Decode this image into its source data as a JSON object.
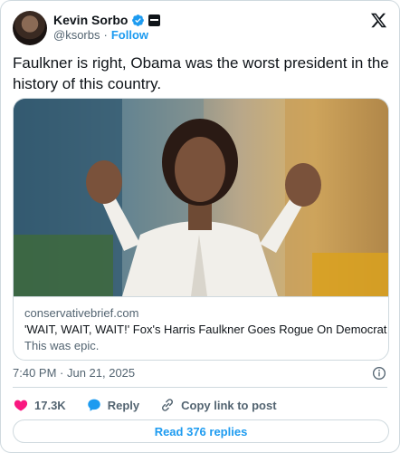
{
  "author": {
    "display_name": "Kevin Sorbo",
    "handle": "@ksorbs",
    "separator": "·",
    "follow_label": "Follow"
  },
  "tweet": {
    "text": "Faulkner is right, Obama was the worst president in the history of this country."
  },
  "link_card": {
    "domain": "conservativebrief.com",
    "title": "'WAIT, WAIT, WAIT!' Fox's Harris Faulkner Goes Rogue On Democrat",
    "description": "This was epic."
  },
  "meta": {
    "timestamp": "7:40 PM · Jun 21, 2025"
  },
  "actions": {
    "like_count": "17.3K",
    "reply_label": "Reply",
    "copy_label": "Copy link to post"
  },
  "footer": {
    "read_replies_label": "Read 376 replies"
  },
  "colors": {
    "accent": "#1d9bf0",
    "like": "#f91880",
    "muted": "#536471",
    "border": "#cfd9de"
  },
  "icons": [
    "x-logo-icon",
    "verified-badge-icon",
    "affiliation-badge-icon",
    "heart-icon",
    "reply-bubble-icon",
    "link-icon",
    "info-icon"
  ]
}
